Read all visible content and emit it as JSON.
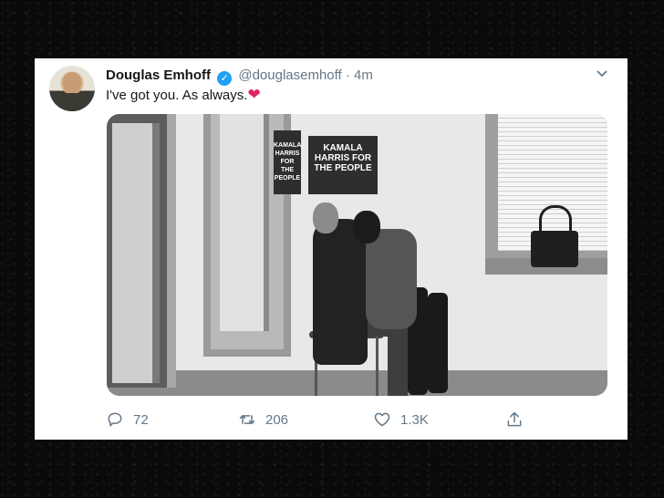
{
  "tweet": {
    "display_name": "Douglas Emhoff",
    "handle": "@douglasemhoff",
    "separator": "·",
    "time": "4m",
    "text": "I've got you. As always.",
    "emoji": "❤",
    "verified": true
  },
  "photo": {
    "poster_small": "KAMALA HARRIS FOR THE PEOPLE",
    "poster_line1": "KAMALA",
    "poster_line2": "HARRIS FOR",
    "poster_line3": "THE PEOPLE"
  },
  "actions": {
    "reply_count": "72",
    "retweet_count": "206",
    "like_count": "1.3K"
  },
  "icons": {
    "verified": "verified-badge-icon",
    "more": "chevron-down-icon",
    "reply": "reply-icon",
    "retweet": "retweet-icon",
    "like": "heart-icon",
    "share": "share-icon"
  },
  "colors": {
    "background": "#0a0a0a",
    "card": "#ffffff",
    "text": "#14171a",
    "muted": "#657786",
    "verified": "#1da1f2",
    "heart": "#e0245e"
  }
}
